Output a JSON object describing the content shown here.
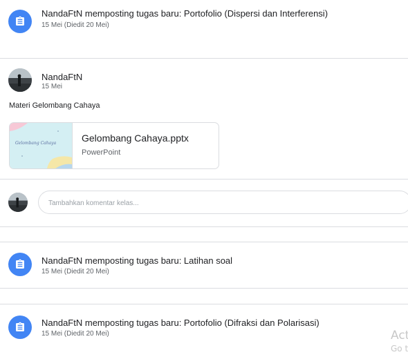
{
  "stream": {
    "tasks": [
      {
        "title": "NandaFtN memposting tugas baru: Portofolio (Dispersi dan Interferensi)",
        "subtitle": "15 Mei (Diedit 20 Mei)",
        "icon": "assignment-icon"
      },
      {
        "title": "NandaFtN memposting tugas baru: Latihan soal",
        "subtitle": "15 Mei (Diedit 20 Mei)",
        "icon": "assignment-icon"
      },
      {
        "title": "NandaFtN memposting tugas baru: Portofolio (Difraksi dan Polarisasi)",
        "subtitle": "15 Mei (Diedit 20 Mei)",
        "icon": "assignment-icon"
      }
    ],
    "post": {
      "author": "NandaFtN",
      "date": "15 Mei",
      "body": "Materi Gelombang Cahaya",
      "attachment": {
        "name": "Gelombang Cahaya.pptx",
        "type": "PowerPoint",
        "thumbnail_text": "Gelombang Cahaya"
      },
      "comment_placeholder": "Tambahkan komentar kelas..."
    }
  },
  "watermark": {
    "line1": "Act",
    "line2": "Go t"
  },
  "colors": {
    "accent": "#4285f4",
    "divider": "#dadce0",
    "secondary_text": "#5f6368"
  }
}
